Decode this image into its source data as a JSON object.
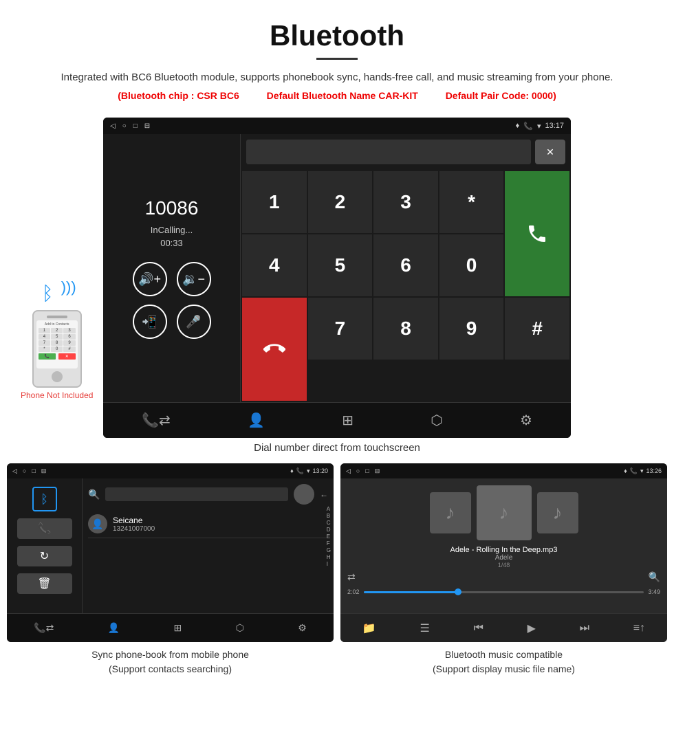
{
  "header": {
    "title": "Bluetooth",
    "subtitle": "Integrated with BC6 Bluetooth module, supports phonebook sync, hands-free call, and music streaming from your phone.",
    "spec1": "(Bluetooth chip : CSR BC6",
    "spec2": "Default Bluetooth Name CAR-KIT",
    "spec3": "Default Pair Code: 0000)"
  },
  "main_screenshot": {
    "status_bar": {
      "time": "13:17"
    },
    "call_number": "10086",
    "call_status": "InCalling...",
    "call_timer": "00:33",
    "numpad_keys": [
      "1",
      "2",
      "3",
      "*",
      "4",
      "5",
      "6",
      "0",
      "7",
      "8",
      "9",
      "#"
    ],
    "caption": "Dial number direct from touchscreen"
  },
  "phonebook_screenshot": {
    "status_bar": {
      "time": "13:20"
    },
    "contact_name": "Seicane",
    "contact_number": "13241007000",
    "alpha_letters": [
      "A",
      "B",
      "C",
      "D",
      "E",
      "F",
      "G",
      "H",
      "I"
    ],
    "caption_line1": "Sync phone-book from mobile phone",
    "caption_line2": "(Support contacts searching)"
  },
  "music_screenshot": {
    "status_bar": {
      "time": "13:26"
    },
    "song_title": "Adele - Rolling In the Deep.mp3",
    "artist": "Adele",
    "track_info": "1/48",
    "time_elapsed": "2:02",
    "time_total": "3:49",
    "caption_line1": "Bluetooth music compatible",
    "caption_line2": "(Support display music file name)"
  },
  "phone_not_included": "Phone Not Included",
  "icons": {
    "bluetooth": "ᛒ",
    "volume_up": "🔊",
    "volume_down": "🔉",
    "transfer": "📲",
    "mic": "🎤",
    "call": "📞",
    "end_call": "📵",
    "contacts": "👤",
    "keypad": "⌨",
    "settings": "⚙",
    "music_note": "♪",
    "shuffle": "⇄",
    "search_music": "🔍",
    "folder": "📁",
    "list": "☰",
    "prev": "⏮",
    "play": "▶",
    "next": "⏭",
    "equalizer": "≡"
  }
}
